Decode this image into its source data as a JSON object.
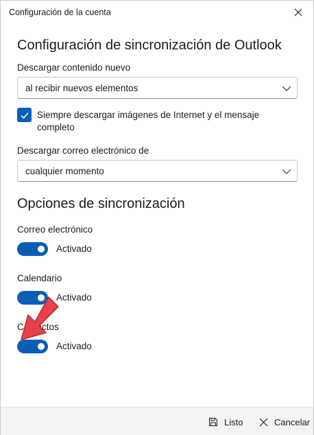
{
  "window": {
    "title": "Configuración de la cuenta"
  },
  "sync_settings": {
    "heading": "Configuración de sincronización de Outlook",
    "download_content_label": "Descargar contenido nuevo",
    "download_content_value": "al recibir nuevos elementos",
    "images_checkbox_label": "Siempre descargar imágenes de Internet y el mensaje completo",
    "images_checkbox_checked": true,
    "download_email_label": "Descargar correo electrónico de",
    "download_email_value": "cualquier momento"
  },
  "sync_options": {
    "heading": "Opciones de sincronización",
    "items": [
      {
        "label": "Correo electrónico",
        "state": "Activado",
        "on": true
      },
      {
        "label": "Calendario",
        "state": "Activado",
        "on": true
      },
      {
        "label": "Contactos",
        "state": "Activado",
        "on": true
      }
    ]
  },
  "footer": {
    "save_label": "Listo",
    "cancel_label": "Cancelar"
  },
  "icons": {
    "close": "close-icon",
    "chevron": "chevron-down-icon",
    "check": "check-icon",
    "save": "save-icon",
    "cancel": "cancel-icon",
    "annotation": "red-arrow-annotation"
  },
  "colors": {
    "accent": "#0a5fb5",
    "footer_bg": "#f3f3f3",
    "annotation": "#e8414a"
  }
}
